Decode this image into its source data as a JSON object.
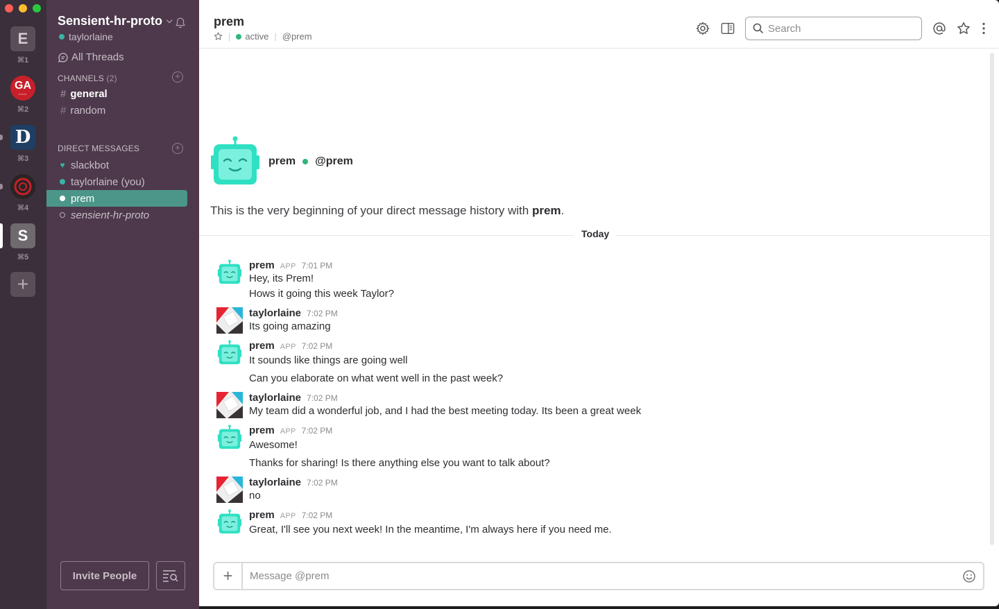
{
  "teams": [
    {
      "letter": "E",
      "shortcut": "⌘1",
      "color": "#5a4e59"
    },
    {
      "letter": "",
      "shortcut": "⌘2",
      "color": "#c8202b"
    },
    {
      "letter": "D",
      "shortcut": "⌘3",
      "color": "#1f3e63"
    },
    {
      "letter": "",
      "shortcut": "⌘4",
      "color": "#2a2424"
    },
    {
      "letter": "S",
      "shortcut": "⌘5",
      "color": "#6e6a6d"
    }
  ],
  "team_ga_label": "GA",
  "sidebar": {
    "workspace": "Sensient-hr-proto",
    "user": "taylorlaine",
    "all_threads": "All Threads",
    "channels_header": "CHANNELS",
    "channels_count": "(2)",
    "channels": [
      "general",
      "random"
    ],
    "dm_header": "DIRECT MESSAGES",
    "dms": [
      "slackbot",
      "taylorlaine (you)",
      "prem",
      "sensient-hr-proto"
    ],
    "invite": "Invite People"
  },
  "header": {
    "title": "prem",
    "status": "active",
    "handle": "@prem",
    "search_placeholder": "Search"
  },
  "intro": {
    "name": "prem",
    "handle": "@prem",
    "line_prefix": "This is the very beginning of your direct message history with",
    "line_name": "prem",
    "line_suffix": "."
  },
  "day_divider": "Today",
  "app_badge": "APP",
  "messages": [
    {
      "author": "prem",
      "time": "7:01 PM",
      "lines": [
        "Hey, its Prem!",
        "Hows it going this week Taylor?"
      ]
    },
    {
      "author": "taylorlaine",
      "time": "7:02 PM",
      "lines": [
        "Its going amazing"
      ]
    },
    {
      "author": "prem",
      "time": "7:02 PM",
      "lines": [
        "It sounds like things are going well",
        "Can you elaborate on what went well in the past week?"
      ]
    },
    {
      "author": "taylorlaine",
      "time": "7:02 PM",
      "lines": [
        "My team did a wonderful job, and I had the best meeting today. Its been a great week"
      ]
    },
    {
      "author": "prem",
      "time": "7:02 PM",
      "lines": [
        "Awesome!",
        "Thanks for sharing! Is there anything else you want to talk about?"
      ]
    },
    {
      "author": "taylorlaine",
      "time": "7:02 PM",
      "lines": [
        "no"
      ]
    },
    {
      "author": "prem",
      "time": "7:02 PM",
      "lines": [
        "Great, I'll see you next week! In the meantime, I'm always here if you need me."
      ]
    }
  ],
  "composer": {
    "placeholder": "Message @prem"
  },
  "colors": {
    "sidebar": "#4d394b",
    "selected": "#4c9689",
    "bot": "#2fe0c3",
    "active": "#2fb67c"
  }
}
